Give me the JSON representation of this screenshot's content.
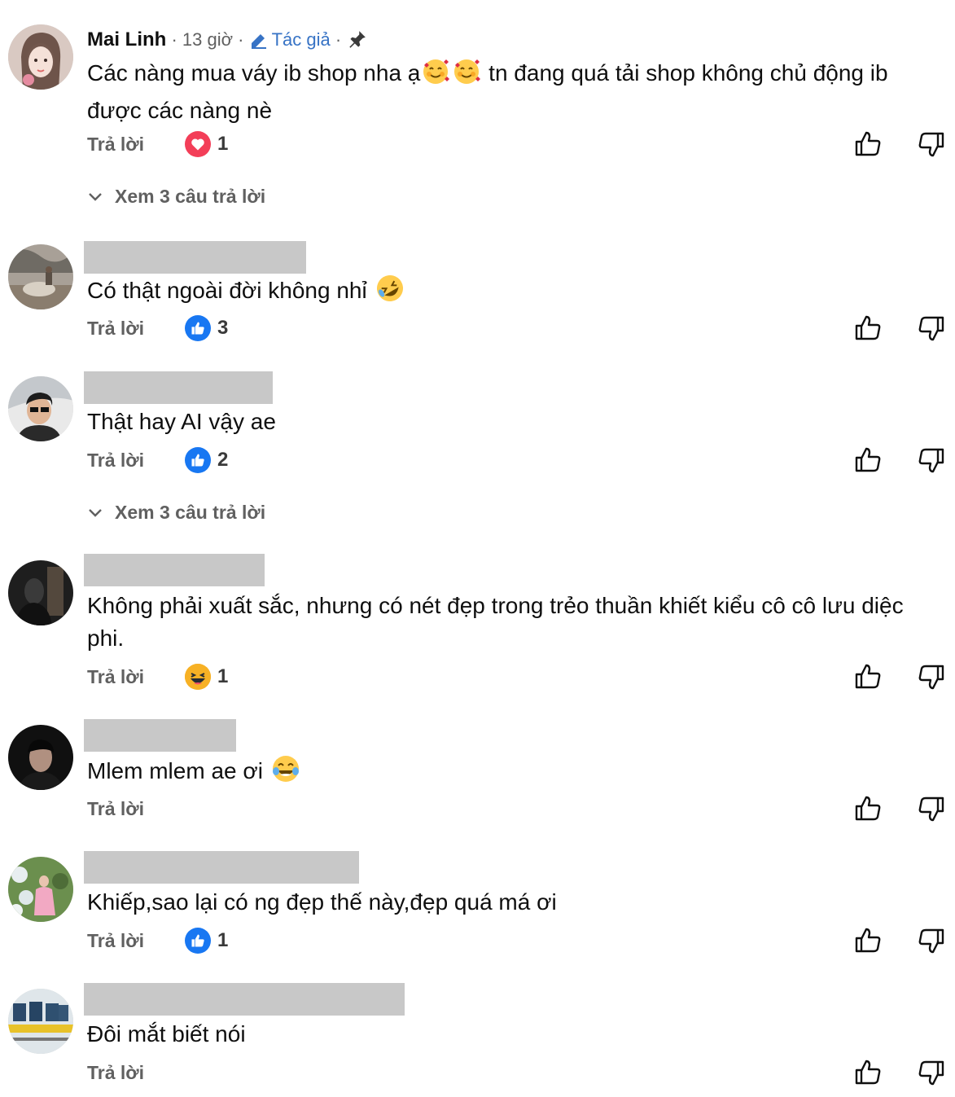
{
  "reply_label": "Trả lời",
  "comments": [
    {
      "author": "Mai Linh",
      "time": "13 giờ",
      "author_badge": "Tác giả",
      "pinned": true,
      "text_before": "Các nàng mua váy ib shop nha ạ",
      "emojis": [
        "smiling-face-with-hearts",
        "smiling-face-with-hearts"
      ],
      "text_after": " tn đang quá tải shop không chủ động ib được các nàng nè",
      "reaction": {
        "type": "heart",
        "count": "1"
      },
      "view_replies": "Xem 3 câu trả lời"
    },
    {
      "text": "Có thật ngoài đời không nhỉ",
      "emoji": "rolling-on-floor-laughing",
      "reaction": {
        "type": "like",
        "count": "3"
      }
    },
    {
      "text": "Thật hay AI vậy ae",
      "reaction": {
        "type": "like",
        "count": "2"
      },
      "view_replies": "Xem 3 câu trả lời"
    },
    {
      "text": "Không phải xuất sắc, nhưng có nét đẹp trong trẻo thuần khiết kiểu cô cô lưu diệc phi.",
      "reaction": {
        "type": "haha",
        "count": "1"
      }
    },
    {
      "text": "Mlem mlem ae ơi",
      "emoji": "face-with-tears-of-joy"
    },
    {
      "text": "Khiếp,sao lại có ng đẹp thế này,đẹp quá má ơi",
      "reaction": {
        "type": "like",
        "count": "1"
      }
    },
    {
      "text": "Đôi mắt biết nói"
    }
  ],
  "colors": {
    "like_blue": "#1877f2",
    "heart_red": "#f33e58",
    "haha_yellow": "#f7b125",
    "author_badge_blue": "#3773c5",
    "muted_gray": "#606060",
    "redaction_gray": "#c8c8c8"
  }
}
